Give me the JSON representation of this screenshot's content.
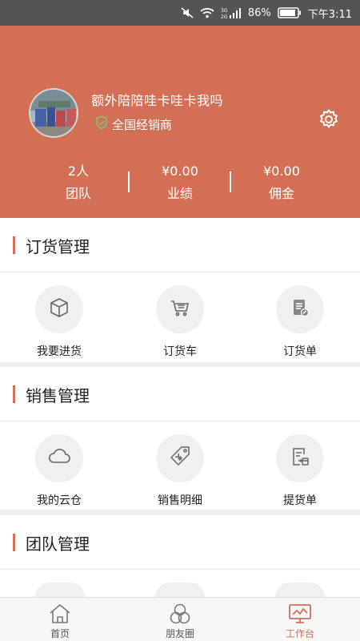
{
  "status_bar": {
    "battery": "86%",
    "time": "下午3:11",
    "network": "3G 2G"
  },
  "profile": {
    "name": "额外陪陪哇卡哇卡我吗",
    "role": "全国经销商",
    "stats": [
      {
        "value": "2人",
        "label": "团队"
      },
      {
        "value": "¥0.00",
        "label": "业绩"
      },
      {
        "value": "¥0.00",
        "label": "佣金"
      }
    ]
  },
  "sections": {
    "order": {
      "title": "订货管理",
      "items": [
        {
          "label": "我要进货",
          "icon": "cube-icon"
        },
        {
          "label": "订货车",
          "icon": "cart-icon"
        },
        {
          "label": "订货单",
          "icon": "order-list-icon"
        }
      ]
    },
    "sales": {
      "title": "销售管理",
      "items": [
        {
          "label": "我的云仓",
          "icon": "cloud-icon"
        },
        {
          "label": "销售明细",
          "icon": "price-tag-icon"
        },
        {
          "label": "提货单",
          "icon": "pickup-list-icon"
        }
      ]
    },
    "team": {
      "title": "团队管理"
    }
  },
  "tabbar": {
    "tabs": [
      {
        "label": "首页",
        "icon": "home-icon"
      },
      {
        "label": "朋友圈",
        "icon": "circles-icon"
      },
      {
        "label": "工作台",
        "icon": "monitor-icon"
      }
    ],
    "active": "工作台"
  },
  "colors": {
    "accent": "#d36f55",
    "status_bar": "#545454"
  }
}
